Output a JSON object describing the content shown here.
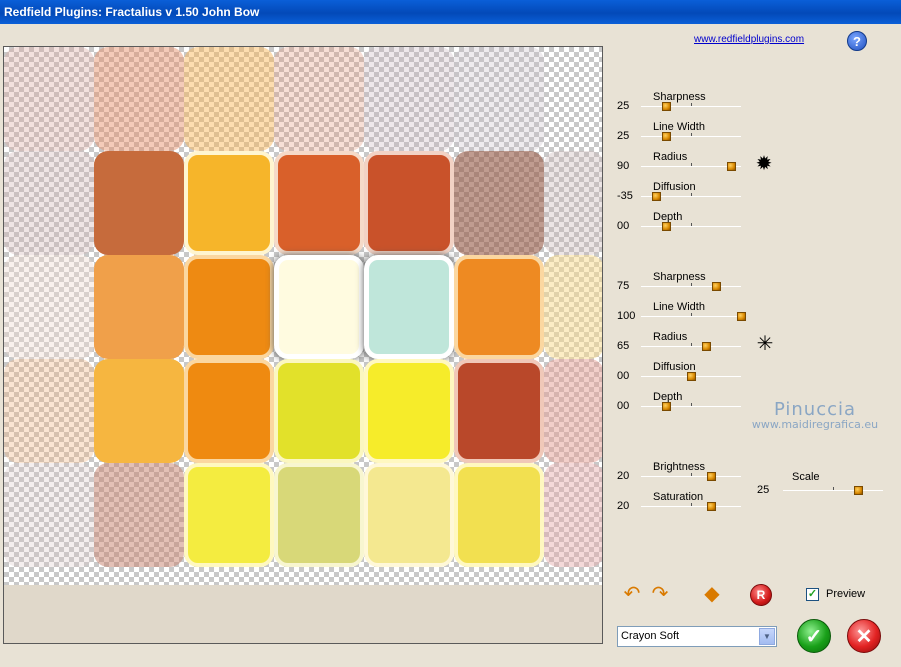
{
  "window": {
    "title": "Redfield Plugins: Fractalius v 1.50   John Bow"
  },
  "link": {
    "text": "www.redfieldplugins.com"
  },
  "help": {
    "label": "?"
  },
  "group1": {
    "sliders": [
      {
        "label": "Sharpness",
        "value": "25",
        "fraction": 0.25
      },
      {
        "label": "Line Width",
        "value": "25",
        "fraction": 0.25
      },
      {
        "label": "Radius",
        "value": "90",
        "fraction": 0.9
      },
      {
        "label": "Diffusion",
        "value": "-35",
        "fraction": 0.15
      },
      {
        "label": "Depth",
        "value": "00",
        "fraction": 0.25
      }
    ],
    "icon": "radius-star-icon"
  },
  "group2": {
    "sliders": [
      {
        "label": "Sharpness",
        "value": "75",
        "fraction": 0.75
      },
      {
        "label": "Line Width",
        "value": "100",
        "fraction": 1.0
      },
      {
        "label": "Radius",
        "value": "65",
        "fraction": 0.65
      },
      {
        "label": "Diffusion",
        "value": "00",
        "fraction": 0.5
      },
      {
        "label": "Depth",
        "value": "00",
        "fraction": 0.25
      }
    ],
    "icon": "radius-star-icon"
  },
  "group3": {
    "sliders": [
      {
        "label": "Brightness",
        "value": "20",
        "fraction": 0.7
      },
      {
        "label": "Saturation",
        "value": "20",
        "fraction": 0.7
      }
    ],
    "scale": {
      "label": "Scale",
      "value": "25",
      "fraction": 0.75
    }
  },
  "watermark": {
    "line1": "Pinuccia",
    "line2": "www.maidiregrafica.eu"
  },
  "preview": {
    "label": "Preview",
    "checked": true
  },
  "preset": {
    "selected": "Crayon Soft"
  },
  "colors": {
    "accent": "#0349b8",
    "thumb": "#d98800"
  }
}
